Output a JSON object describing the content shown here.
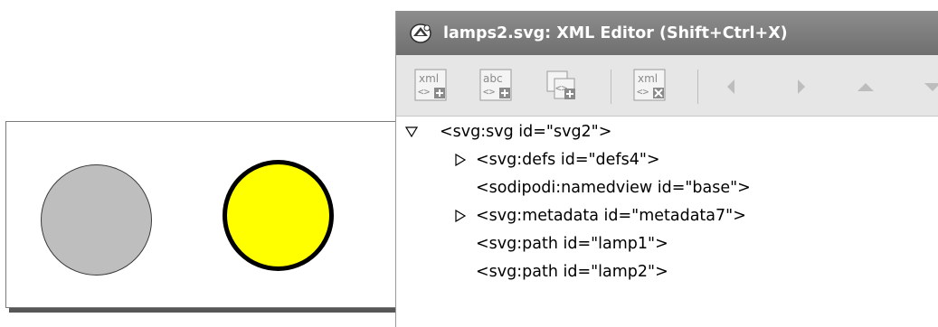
{
  "canvas": {
    "lamps": [
      {
        "id": "lamp1",
        "fill": "#bebebe",
        "stroke": "#3a3a3a"
      },
      {
        "id": "lamp2",
        "fill": "#ffff00",
        "stroke": "#000000"
      }
    ]
  },
  "xml_editor": {
    "title": "lamps2.svg: XML Editor (Shift+Ctrl+X)",
    "toolbar": {
      "new_element_icon_text": "xml",
      "new_text_icon_text": "abc",
      "delete_icon_text": "xml"
    },
    "nodes": [
      {
        "text": "<svg:svg id=\"svg2\">",
        "expander": "down"
      },
      {
        "text": "<svg:defs id=\"defs4\">",
        "expander": "right"
      },
      {
        "text": "<sodipodi:namedview id=\"base\">",
        "expander": ""
      },
      {
        "text": "<svg:metadata id=\"metadata7\">",
        "expander": "right"
      },
      {
        "text": "<svg:path id=\"lamp1\">",
        "expander": ""
      },
      {
        "text": "<svg:path id=\"lamp2\">",
        "expander": ""
      }
    ]
  }
}
